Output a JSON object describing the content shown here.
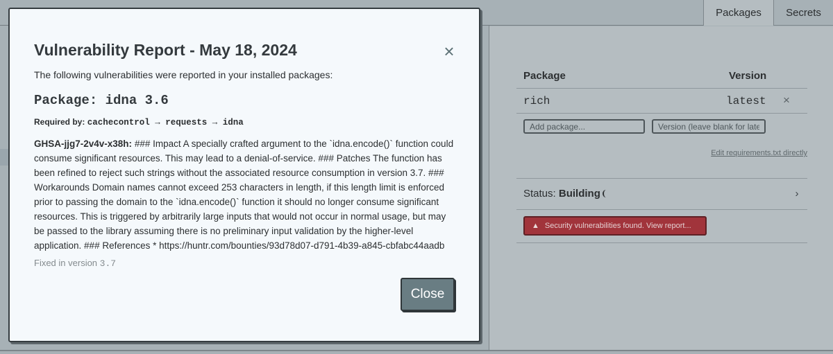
{
  "tabs": [
    {
      "label": "Packages",
      "active": true
    },
    {
      "label": "Secrets",
      "active": false
    }
  ],
  "packages": {
    "headers": {
      "package": "Package",
      "version": "Version"
    },
    "rows": [
      {
        "name": "rich",
        "version": "latest"
      }
    ],
    "remove_icon": "×",
    "add_package_placeholder": "Add package...",
    "version_placeholder": "Version (leave blank for latest)",
    "edit_link": "Edit requirements.txt directly"
  },
  "status": {
    "label": "Status:",
    "value": "Building",
    "chevron": "›"
  },
  "vuln_banner": {
    "icon": "▲",
    "text": "Security vulnerabilities found. View report..."
  },
  "modal": {
    "title": "Vulnerability Report - May 18, 2024",
    "close_icon": "×",
    "intro": "The following vulnerabilities were reported in your installed packages:",
    "package_title": "Package: idna 3.6",
    "required_by_label": "Required by:",
    "required_chain": "cachecontrol → requests → idna",
    "advisory_id": "GHSA-jjg7-2v4v-x38h:",
    "advisory_text": "### Impact A specially crafted argument to the `idna.encode()` function could consume significant resources. This may lead to a denial-of-service. ### Patches The function has been refined to reject such strings without the associated resource consumption in version 3.7. ### Workarounds Domain names cannot exceed 253 characters in length, if this length limit is enforced prior to passing the domain to the `idna.encode()` function it should no longer consume significant resources. This is triggered by arbitrarily large inputs that would not occur in normal usage, but may be passed to the library assuming there is no preliminary input validation by the higher-level application. ### References * https://huntr.com/bounties/93d78d07-d791-4b39-a845-cbfabc44aadb",
    "fixed_label": "Fixed in version",
    "fixed_version": "3.7",
    "close_button": "Close"
  },
  "colors": {
    "modal_bg": "#f5f9fc",
    "close_button_bg": "#697d83",
    "danger": "#a1343b"
  }
}
